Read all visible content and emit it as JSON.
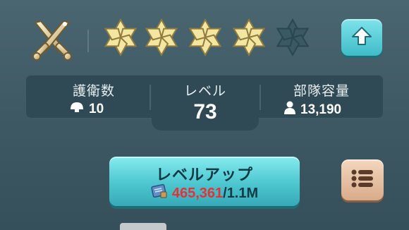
{
  "header": {
    "rank_icon": "crossed-swords-icon",
    "stars_total": 5,
    "stars_filled": 4,
    "star_icon": "star-flower-icon",
    "upgrade_icon": "arrow-up-icon"
  },
  "stats": {
    "guards": {
      "label": "護衛数",
      "value": "10",
      "icon": "helmet-icon"
    },
    "level": {
      "label": "レベル",
      "value": "73"
    },
    "capacity": {
      "label": "部隊容量",
      "value": "13,190",
      "icon": "person-icon"
    }
  },
  "level_up": {
    "label": "レベルアップ",
    "resource_icon": "blueprint-scroll-icon",
    "current": "465,361",
    "separator": "/",
    "required": "1.1M"
  },
  "menu": {
    "icon": "list-icon"
  },
  "colors": {
    "accent_cyan": "#4cc6cf",
    "star_gold": "#f3e6a0",
    "star_empty": "#3a5963",
    "insufficient_red": "#e0343a",
    "menu_tan": "#e6c2a4"
  }
}
